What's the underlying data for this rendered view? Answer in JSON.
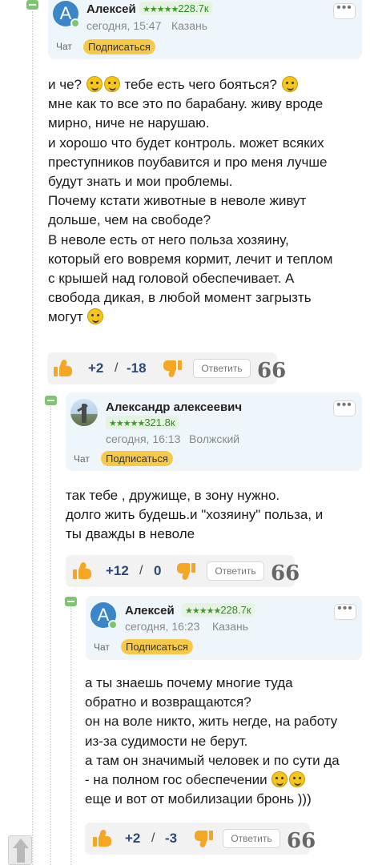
{
  "comments": [
    {
      "author": "Алексей",
      "rating": "228.7к",
      "time": "сегодня, 15:47",
      "city": "Казань",
      "chat_label": "Чат",
      "subscribe_label": "Подписаться",
      "text_lines": [
        "и че? {e}{e} тебе есть чего бояться? {e}",
        "мне как то все это по барабану. живу вроде",
        "мирно, ниче не нарушаю.",
        "и хорошо что будет контроль. может всяких",
        "преступников поубавится и про меня лучше",
        "будут знать и мои проблемы.",
        "Почему кстати животные в неволе живут",
        "дольше, чем на свободе?",
        "В неволе есть от него польза хозяину,",
        "который его вовремя кормит, лечит и теплом",
        "с крышей над головой обеспечивает. А",
        "свобода дикая, в любой момент загрызть",
        "могут {e}"
      ],
      "plus": "+2",
      "minus": "-18",
      "reply_label": "Ответить",
      "quote_glyph": "66"
    },
    {
      "author": "Александр алексеевич",
      "rating": "321.8к",
      "time": "сегодня, 16:13",
      "city": "Волжский",
      "chat_label": "Чат",
      "subscribe_label": "Подписаться",
      "text_lines": [
        "так тебе , дружище, в зону нужно.",
        "долго жить будешь.и \"хозяину\" польза, и",
        "ты дважды в неволе"
      ],
      "plus": "+12",
      "minus": "0",
      "reply_label": "Ответить",
      "quote_glyph": "66"
    },
    {
      "author": "Алексей",
      "rating": "228.7к",
      "time": "сегодня, 16:23",
      "city": "Казань",
      "chat_label": "Чат",
      "subscribe_label": "Подписаться",
      "text_lines": [
        "а ты знаешь почему многие туда",
        "обратно и возвращаются?",
        "он на воле никто, жить негде, на работу",
        "из-за судимости не берут.",
        "а там он значимый человек и по сути да",
        "- на полном гос обеспечении {e}{e}",
        "еще и вот от мобилизации бронь )))"
      ],
      "plus": "+2",
      "minus": "-3",
      "reply_label": "Ответить",
      "quote_glyph": "66"
    }
  ],
  "avatar_letter": "A",
  "stars": "★★★★★",
  "slash": "/",
  "menu_dots": "•••",
  "colors": {
    "accent_green": "#7cc66d",
    "header_bg": "#eef6fb",
    "subscribe_yellow": "#f7c948",
    "thumb_orange": "#f5a623",
    "score_blue": "#2a4a7a"
  },
  "icons": [
    "collapse-icon",
    "more-icon",
    "thumb-up-icon",
    "thumb-down-icon",
    "quote-icon",
    "scroll-up-icon",
    "emoji-icon"
  ]
}
